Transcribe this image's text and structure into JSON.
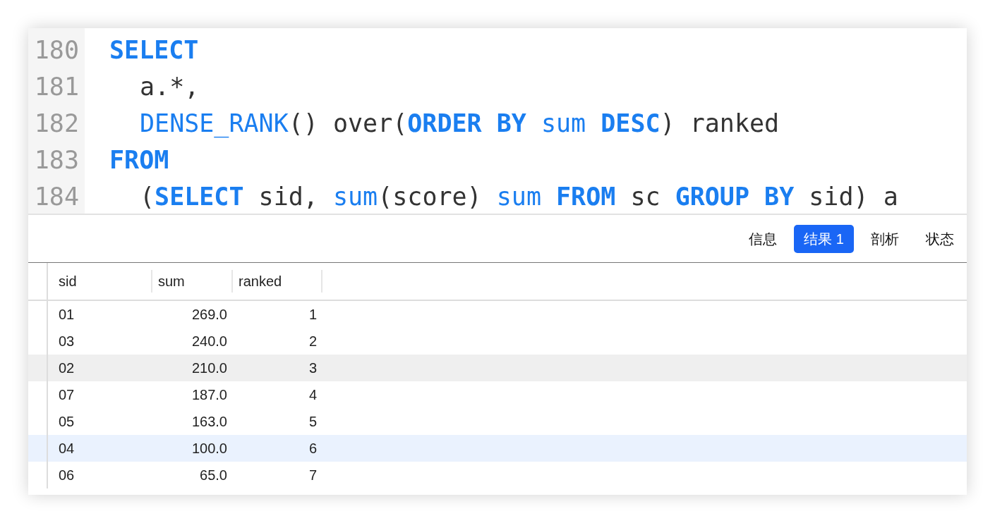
{
  "editor": {
    "lines": [
      {
        "number": "180",
        "indented": false,
        "tokens": [
          {
            "kind": "keyword",
            "text": "SELECT"
          }
        ]
      },
      {
        "number": "181",
        "indented": true,
        "tokens": [
          {
            "kind": "plain",
            "text": "a.*,"
          }
        ]
      },
      {
        "number": "182",
        "indented": true,
        "tokens": [
          {
            "kind": "function",
            "text": "DENSE_RANK"
          },
          {
            "kind": "plain",
            "text": "() over("
          },
          {
            "kind": "keyword",
            "text": "ORDER BY "
          },
          {
            "kind": "function",
            "text": "sum "
          },
          {
            "kind": "keyword",
            "text": "DESC"
          },
          {
            "kind": "plain",
            "text": ") ranked"
          }
        ]
      },
      {
        "number": "183",
        "indented": false,
        "tokens": [
          {
            "kind": "keyword",
            "text": "FROM"
          }
        ]
      },
      {
        "number": "184",
        "indented": true,
        "tokens": [
          {
            "kind": "plain",
            "text": "("
          },
          {
            "kind": "keyword",
            "text": "SELECT"
          },
          {
            "kind": "plain",
            "text": " sid, "
          },
          {
            "kind": "function",
            "text": "sum"
          },
          {
            "kind": "plain",
            "text": "(score) "
          },
          {
            "kind": "function",
            "text": "sum "
          },
          {
            "kind": "keyword",
            "text": "FROM"
          },
          {
            "kind": "plain",
            "text": " sc "
          },
          {
            "kind": "keyword",
            "text": "GROUP BY"
          },
          {
            "kind": "plain",
            "text": " sid) a"
          }
        ]
      }
    ]
  },
  "tabs": [
    {
      "label": "信息",
      "selected": false
    },
    {
      "label": "结果 1",
      "selected": true
    },
    {
      "label": "剖析",
      "selected": false
    },
    {
      "label": "状态",
      "selected": false
    }
  ],
  "table": {
    "columns": [
      {
        "label": "sid"
      },
      {
        "label": "sum"
      },
      {
        "label": "ranked"
      }
    ],
    "rows": [
      {
        "cells": [
          "01",
          "269.0",
          "1"
        ],
        "hovered": false,
        "selected": false
      },
      {
        "cells": [
          "03",
          "240.0",
          "2"
        ],
        "hovered": false,
        "selected": false
      },
      {
        "cells": [
          "02",
          "210.0",
          "3"
        ],
        "hovered": true,
        "selected": false
      },
      {
        "cells": [
          "07",
          "187.0",
          "4"
        ],
        "hovered": false,
        "selected": false
      },
      {
        "cells": [
          "05",
          "163.0",
          "5"
        ],
        "hovered": false,
        "selected": false
      },
      {
        "cells": [
          "04",
          "100.0",
          "6"
        ],
        "hovered": false,
        "selected": true
      },
      {
        "cells": [
          "06",
          "65.0",
          "7"
        ],
        "hovered": false,
        "selected": false
      }
    ]
  }
}
